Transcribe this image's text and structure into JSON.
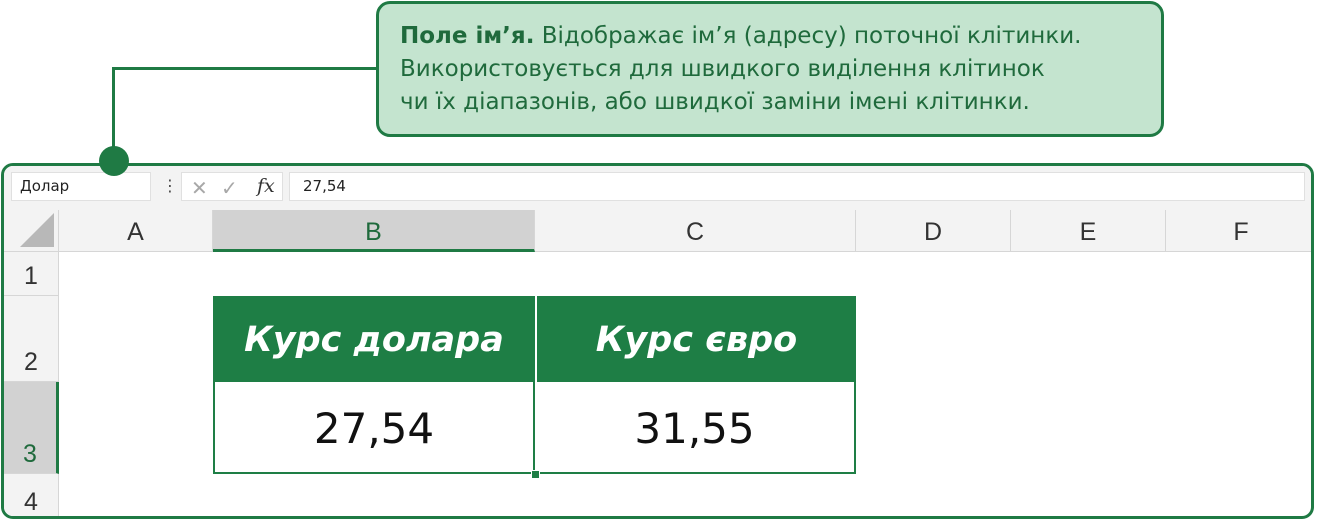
{
  "callout": {
    "title": "Поле ім’я.",
    "text_line1": "Відображає ім’я (адресу) поточної клітинки.",
    "text_line2": "Використовується для швидкого виділення клітинок",
    "text_line3": "чи їх діапазонів, або швидкої заміни імені клітинки."
  },
  "formula_bar": {
    "name_box": "Долар",
    "more_icon": "⋮",
    "cancel_icon": "✕",
    "enter_icon": "✓",
    "fx_label": "fx",
    "formula_value": "27,54"
  },
  "columns": [
    "A",
    "B",
    "C",
    "D",
    "E",
    "F"
  ],
  "rows": [
    "1",
    "2",
    "3",
    "4"
  ],
  "table": {
    "header_b": "Курс долара",
    "header_c": "Курс євро",
    "value_b": "27,54",
    "value_c": "31,55"
  },
  "colors": {
    "accent": "#1f7a44",
    "callout_bg": "#c4e4cf",
    "table_header_bg": "#1e7e45"
  }
}
